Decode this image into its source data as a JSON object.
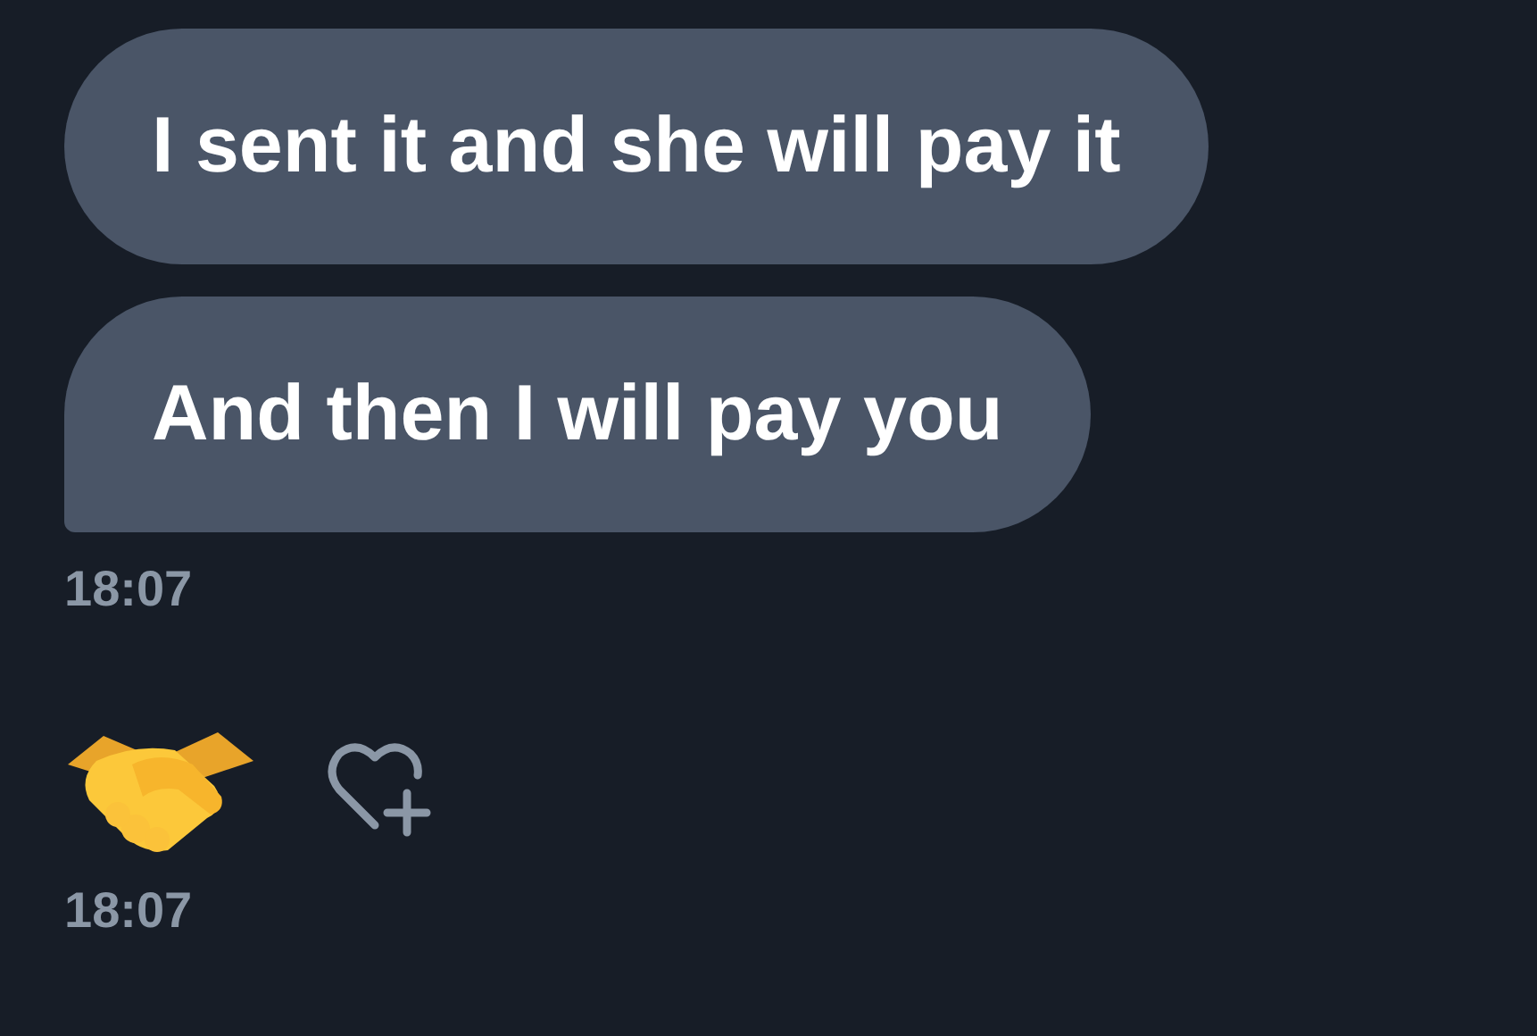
{
  "groups": [
    {
      "messages": [
        {
          "kind": "text",
          "text": "I sent it and she will pay it"
        },
        {
          "kind": "text",
          "text": "And then I will pay you"
        }
      ],
      "time": "18:07"
    },
    {
      "messages": [
        {
          "kind": "emoji"
        }
      ],
      "time": "18:07"
    }
  ]
}
